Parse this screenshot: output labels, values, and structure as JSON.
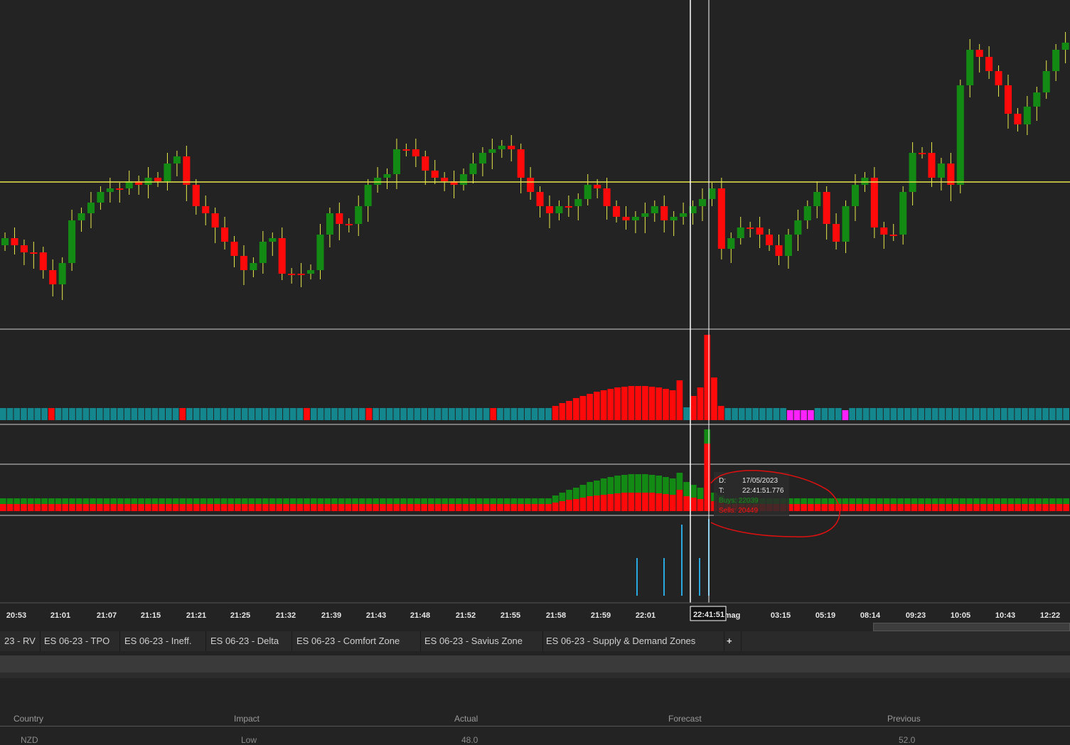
{
  "chart_data": {
    "type": "candlestick",
    "symbol_tabs": [
      "23 - RV",
      "ES 06-23 - TPO",
      "ES 06-23 - Ineff.",
      "ES 06-23 - Delta",
      "ES 06-23 - Comfort Zone",
      "ES 06-23 - Savius Zone",
      "ES 06-23 - Supply & Demand Zones"
    ],
    "time_labels": [
      "20:53",
      "21:01",
      "21:07",
      "21:15",
      "21:21",
      "21:25",
      "21:32",
      "21:39",
      "21:43",
      "21:48",
      "21:52",
      "21:55",
      "21:58",
      "21:59",
      "22:01",
      "22:41:51",
      "mag",
      "03:15",
      "05:19",
      "08:14",
      "09:23",
      "10:05",
      "10:43",
      "12:22"
    ],
    "crosshair_time": "22:41:51",
    "colors": {
      "up": "#138a13",
      "down": "#ff0a0a",
      "volume": "#13868e",
      "highlight": "#ff22ff",
      "level": "#e8e84a",
      "cvd": "#2aa8e0",
      "bg": "#232323"
    },
    "closes": [
      335,
      345,
      355,
      355,
      380,
      400,
      370,
      310,
      300,
      285,
      270,
      265,
      265,
      255,
      260,
      250,
      255,
      230,
      220,
      260,
      290,
      300,
      320,
      340,
      360,
      380,
      370,
      340,
      335,
      385,
      385,
      385,
      380,
      330,
      300,
      315,
      315,
      290,
      260,
      250,
      245,
      210,
      210,
      220,
      240,
      250,
      255,
      260,
      245,
      230,
      215,
      210,
      205,
      210,
      250,
      270,
      290,
      300,
      290,
      290,
      280,
      260,
      265,
      290,
      305,
      310,
      305,
      300,
      290,
      310,
      305,
      300,
      290,
      280,
      265,
      350,
      335,
      320,
      320,
      330,
      345,
      360,
      330,
      310,
      290,
      270,
      315,
      340,
      290,
      260,
      250,
      320,
      330,
      330,
      270,
      215,
      215,
      250,
      230,
      260,
      120,
      70,
      80,
      100,
      120,
      160,
      175,
      150,
      130,
      100,
      70,
      60
    ]
  },
  "tooltip": {
    "d_label": "D:",
    "date": "17/05/2023",
    "t_label": "T:",
    "time": "22:41:51.776",
    "buys": "Buys: 22039",
    "sells": "Sells: 20449"
  },
  "calendar": {
    "headers": [
      "Country",
      "Impact",
      "Actual",
      "Forecast",
      "Previous"
    ],
    "row": [
      "NZD",
      "Low",
      "48.0",
      "",
      "52.0"
    ]
  }
}
